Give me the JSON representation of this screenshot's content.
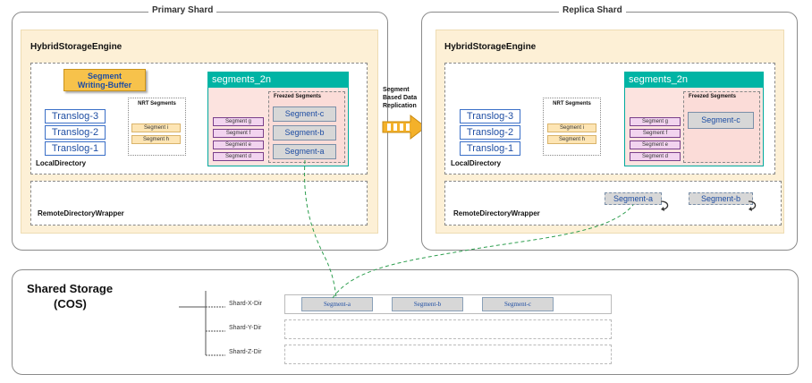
{
  "primary": {
    "title": "Primary Shard",
    "engine_title": "HybridStorageEngine",
    "writing_buffer": [
      "Segment",
      "Writing-Buffer"
    ],
    "translogs": [
      "Translog-3",
      "Translog-2",
      "Translog-1"
    ],
    "local_label": "LocalDirectory",
    "nrt_title": "NRT Segments",
    "nrt_segments": [
      "Segment i",
      "Segment h"
    ],
    "segments_header": "segments_2n",
    "pink_segments": [
      "Segment g",
      "Segment f",
      "Segment e",
      "Segment d"
    ],
    "freezed_title": "Freezed Segments",
    "freezed_segments": [
      "Segment-c",
      "Segment-b",
      "Segment-a"
    ],
    "remote_label": "RemoteDirectoryWrapper"
  },
  "replication": {
    "label": [
      "Segment",
      "Based Data",
      "Replication"
    ]
  },
  "replica": {
    "title": "Replica Shard",
    "engine_title": "HybridStorageEngine",
    "translogs": [
      "Translog-3",
      "Translog-2",
      "Translog-1"
    ],
    "local_label": "LocalDirectory",
    "nrt_title": "NRT Segments",
    "nrt_segments": [
      "Segment i",
      "Segment h"
    ],
    "segments_header": "segments_2n",
    "pink_segments": [
      "Segment g",
      "Segment f",
      "Segment e",
      "Segment d"
    ],
    "freezed_title": "Freezed Segments",
    "freezed_segments": [
      "Segment-c"
    ],
    "remote_label": "RemoteDirectoryWrapper",
    "remote_segments": [
      "Segment-a",
      "Segment-b"
    ]
  },
  "shared": {
    "title": "Shared Storage",
    "subtitle": "(COS)",
    "dirs": [
      {
        "name": "Shard-X-Dir",
        "segments": [
          "Segment-a",
          "Segment-b",
          "Segment-c"
        ]
      },
      {
        "name": "Shard-Y-Dir",
        "segments": []
      },
      {
        "name": "Shard-Z-Dir",
        "segments": []
      }
    ]
  },
  "colors": {
    "engine_bg": "#fdf0d6",
    "segments_header": "#00b4a4",
    "writing_buffer": "#f7c24b",
    "link_dashed": "#2e9e4f"
  }
}
